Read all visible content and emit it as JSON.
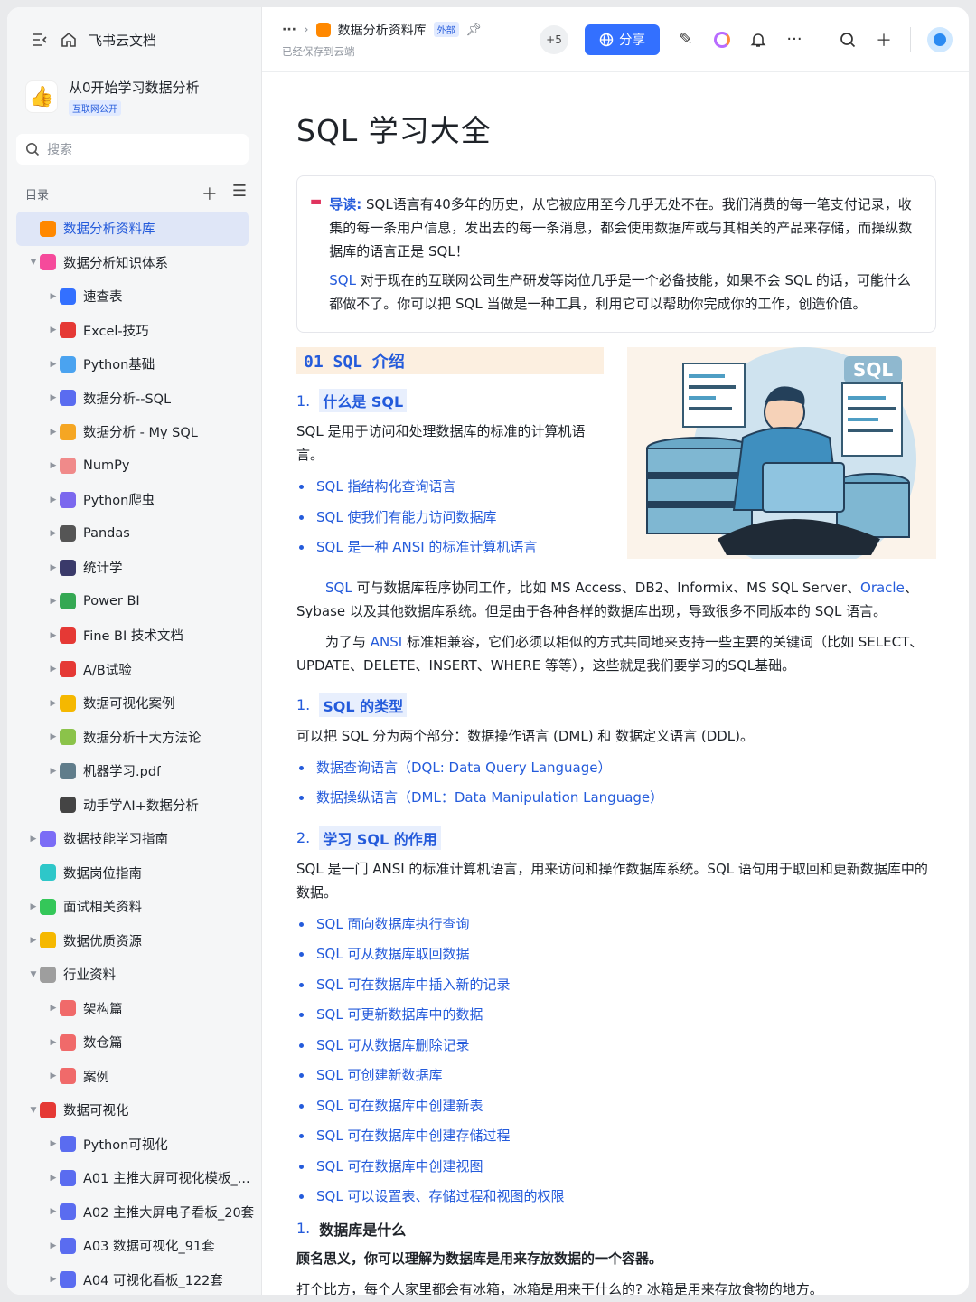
{
  "sidebar": {
    "app_name": "飞书云文档",
    "workspace": {
      "title": "从0开始学习数据分析",
      "tag": "互联网公开"
    },
    "search_placeholder": "搜索",
    "toc_label": "目录",
    "tree": [
      {
        "label": "数据分析资料库",
        "level": 0,
        "caret": "",
        "icon": "db-icon",
        "color": "#ff8800",
        "active": true
      },
      {
        "label": "数据分析知识体系",
        "level": 0,
        "caret": "▼",
        "icon": "knowledge-icon",
        "color": "#f54a9b"
      },
      {
        "label": "速查表",
        "level": 1,
        "caret": "▶",
        "icon": "magnifier-icon",
        "color": "#3370ff"
      },
      {
        "label": "Excel-技巧",
        "level": 1,
        "caret": "▶",
        "icon": "hundred-icon",
        "color": "#e53935"
      },
      {
        "label": "Python基础",
        "level": 1,
        "caret": "▶",
        "icon": "screen-icon",
        "color": "#4aa3f0"
      },
      {
        "label": "数据分析--SQL",
        "level": 1,
        "caret": "▶",
        "icon": "bar-chart-icon",
        "color": "#5a6cf0"
      },
      {
        "label": "数据分析 - My SQL",
        "level": 1,
        "caret": "▶",
        "icon": "rainbow-icon",
        "color": "#f5a623"
      },
      {
        "label": "NumPy",
        "level": 1,
        "caret": "▶",
        "icon": "memo-icon",
        "color": "#f08a8a"
      },
      {
        "label": "Python爬虫",
        "level": 1,
        "caret": "▶",
        "icon": "spider-icon",
        "color": "#7b68ee"
      },
      {
        "label": "Pandas",
        "level": 1,
        "caret": "▶",
        "icon": "panda-icon",
        "color": "#555555"
      },
      {
        "label": "统计学",
        "level": 1,
        "caret": "▶",
        "icon": "floppy-icon",
        "color": "#3a3a6a"
      },
      {
        "label": "Power BI",
        "level": 1,
        "caret": "▶",
        "icon": "recycle-icon",
        "color": "#34a853"
      },
      {
        "label": "Fine BI 技术文档",
        "level": 1,
        "caret": "▶",
        "icon": "pin-icon",
        "color": "#e53935"
      },
      {
        "label": "A/B试验",
        "level": 1,
        "caret": "▶",
        "icon": "ab-icon",
        "color": "#e53935"
      },
      {
        "label": "数据可视化案例",
        "level": 1,
        "caret": "▶",
        "icon": "medal-icon",
        "color": "#f5b800"
      },
      {
        "label": "数据分析十大方法论",
        "level": 1,
        "caret": "▶",
        "icon": "puzzle-icon",
        "color": "#8bc34a"
      },
      {
        "label": "机器学习.pdf",
        "level": 1,
        "caret": "▶",
        "icon": "robot-icon",
        "color": "#607d8b"
      },
      {
        "label": "动手学AI+数据分析",
        "level": 1,
        "caret": "",
        "icon": "traffic-light-icon",
        "color": "#444444"
      },
      {
        "label": "数据技能学习指南",
        "level": 0,
        "caret": "▶",
        "icon": "skill-icon",
        "color": "#7b6cf6"
      },
      {
        "label": "数据岗位指南",
        "level": 0,
        "caret": "",
        "icon": "job-icon",
        "color": "#2ec7c9"
      },
      {
        "label": "面试相关资料",
        "level": 0,
        "caret": "▶",
        "icon": "interview-icon",
        "color": "#34c759"
      },
      {
        "label": "数据优质资源",
        "level": 0,
        "caret": "▶",
        "icon": "thumb-icon",
        "color": "#f5b800"
      },
      {
        "label": "行业资料",
        "level": 0,
        "caret": "▼",
        "icon": "note-icon",
        "color": "#9e9e9e"
      },
      {
        "label": "架构篇",
        "level": 1,
        "caret": "▶",
        "icon": "arch-icon",
        "color": "#f06a6a"
      },
      {
        "label": "数仓篇",
        "level": 1,
        "caret": "▶",
        "icon": "warehouse-icon",
        "color": "#f06a6a"
      },
      {
        "label": "案例",
        "level": 1,
        "caret": "▶",
        "icon": "case-icon",
        "color": "#f06a6a"
      },
      {
        "label": "数据可视化",
        "level": 0,
        "caret": "▼",
        "icon": "rocket-icon",
        "color": "#e53935"
      },
      {
        "label": "Python可视化",
        "level": 1,
        "caret": "▶",
        "icon": "bar-chart-icon",
        "color": "#5a6cf0"
      },
      {
        "label": "A01 主推大屏可视化模板_...",
        "level": 1,
        "caret": "▶",
        "icon": "bar-chart-icon",
        "color": "#5a6cf0"
      },
      {
        "label": "A02 主推大屏电子看板_20套",
        "level": 1,
        "caret": "▶",
        "icon": "bar-chart-icon",
        "color": "#5a6cf0"
      },
      {
        "label": "A03 数据可视化_91套",
        "level": 1,
        "caret": "▶",
        "icon": "bar-chart-icon",
        "color": "#5a6cf0"
      },
      {
        "label": "A04 可视化看板_122套",
        "level": 1,
        "caret": "▶",
        "icon": "bar-chart-icon",
        "color": "#5a6cf0"
      }
    ]
  },
  "topbar": {
    "breadcrumb_more": "···",
    "breadcrumb_current": "数据分析资料库",
    "external_tag": "外部",
    "saved_status": "已经保存到云端",
    "collaborators_more": "+5",
    "share_label": "分享"
  },
  "doc": {
    "title": "SQL 学习大全",
    "callout": {
      "lead": "导读:",
      "p1": "SQL语言有40多年的历史，从它被应用至今几乎无处不在。我们消费的每一笔支付记录，收集的每一条用户信息，发出去的每一条消息，都会使用数据库或与其相关的产品来存储，而操纵数据库的语言正是 SQL！",
      "p2_link": "SQL",
      "p2_rest": " 对于现在的互联网公司生产研发等岗位几乎是一个必备技能，如果不会 SQL 的话，可能什么都做不了。你可以把 SQL 当做是一种工具，利用它可以帮助你完成你的工作，创造价值。"
    },
    "section01": "01  SQL  介绍",
    "h_what": {
      "num": "1.",
      "text": "什么是  SQL"
    },
    "what_para": "SQL 是用于访问和处理数据库的标准的计算机语言。",
    "what_bullets": [
      "SQL 指结构化查询语言",
      "SQL 使我们有能力访问数据库",
      "SQL 是一种 ANSI 的标准计算机语言"
    ],
    "illus_label": "SQL",
    "para_compat": {
      "link1": "SQL",
      "text1": " 可与数据库程序协同工作，比如 MS Access、DB2、Informix、MS SQL Server、",
      "link2": "Oracle",
      "text2": "、Sybase 以及其他数据库系统。但是由于各种各样的数据库出现，导致很多不同版本的 SQL 语言。"
    },
    "para_ansi": {
      "text1": "为了与 ",
      "link": "ANSI",
      "text2": " 标准相兼容，它们必须以相似的方式共同地来支持一些主要的关键词（比如 SELECT、UPDATE、DELETE、INSERT、WHERE 等等），这些就是我们要学习的SQL基础。"
    },
    "h_types": {
      "num": "1.",
      "text": "SQL  的类型"
    },
    "types_para": "可以把 SQL 分为两个部分：数据操作语言 (DML) 和 数据定义语言 (DDL)。",
    "types_bullets": [
      "数据查询语言（DQL: Data Query Language）",
      "数据操纵语言（DML：Data Manipulation Language）"
    ],
    "h_use": {
      "num": "2.",
      "text": "学习  SQL  的作用"
    },
    "use_para": "SQL 是一门 ANSI 的标准计算机语言，用来访问和操作数据库系统。SQL 语句用于取回和更新数据库中的数据。",
    "use_bullets": [
      "SQL 面向数据库执行查询",
      "SQL 可从数据库取回数据",
      "SQL 可在数据库中插入新的记录",
      "SQL 可更新数据库中的数据",
      "SQL 可从数据库删除记录",
      "SQL 可创建新数据库",
      "SQL 可在数据库中创建新表",
      "SQL 可在数据库中创建存储过程",
      "SQL 可在数据库中创建视图",
      "SQL 可以设置表、存储过程和视图的权限"
    ],
    "h_db": {
      "num": "1.",
      "text": "数据库是什么"
    },
    "db_bold": "顾名思义，你可以理解为数据库是用来存放数据的一个容器。",
    "db_para": "打个比方，每个人家里都会有冰箱，冰箱是用来干什么的? 冰箱是用来存放食物的地方。"
  }
}
